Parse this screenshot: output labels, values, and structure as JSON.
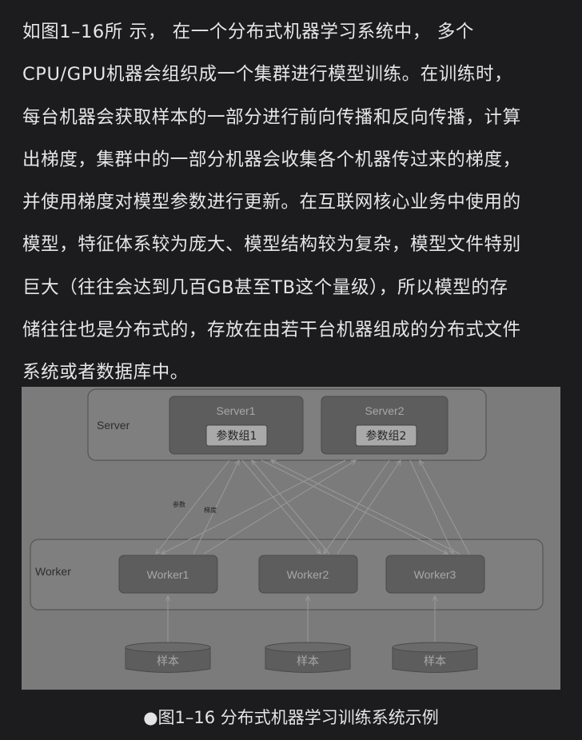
{
  "article": {
    "lines": [
      "如图1–16所 示， 在一个分布式机器学习系统中， 多个",
      "CPU/GPU机器会组织成一个集群进行模型训练。在训练时，",
      "每台机器会获取样本的一部分进行前向传播和反向传播，计算",
      "出梯度，集群中的一部分机器会收集各个机器传过来的梯度，",
      "并使用梯度对模型参数进行更新。在互联网核心业务中使用的",
      "模型，特征体系较为庞大、模型结构较为复杂，模型文件特别",
      "巨大（往往会达到几百GB甚至TB这个量级），所以模型的存",
      "储往往也是分布式的，存放在由若干台机器组成的分布式文件",
      "系统或者数据库中。"
    ]
  },
  "figure": {
    "server_group_label": "Server",
    "worker_group_label": "Worker",
    "servers": [
      {
        "name": "Server1",
        "param_group": "参数组1"
      },
      {
        "name": "Server2",
        "param_group": "参数组2"
      }
    ],
    "workers": [
      "Worker1",
      "Worker2",
      "Worker3"
    ],
    "samples": [
      "样本",
      "样本",
      "样本"
    ],
    "arrow_labels": {
      "params": "参数",
      "gradient": "梯度"
    },
    "colors": {
      "background": "#7b7b7b",
      "box": "#5d5d5d",
      "box_stroke": "#4a4a4a",
      "group_stroke": "#555555",
      "text_light": "#aaaaaa",
      "line": "#9a9a9a"
    }
  },
  "caption": {
    "bullet": "●",
    "text": "图1–16 分布式机器学习训练系统示例"
  }
}
